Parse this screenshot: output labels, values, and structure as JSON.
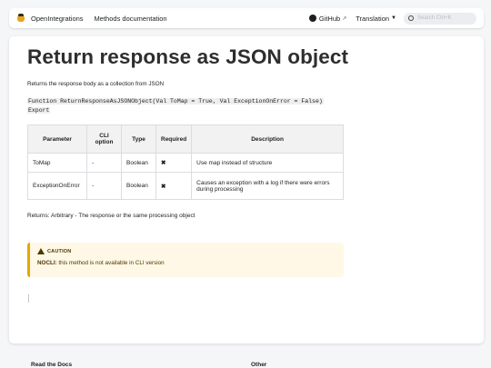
{
  "navbar": {
    "brand": "OpenIntegrations",
    "links": [
      "Methods documentation"
    ],
    "github": "GitHub",
    "translation": "Translation",
    "search_placeholder": "Search Ctrl+K"
  },
  "page": {
    "title": "Return response as JSON object",
    "description": "Returns the response body as a collection from JSON",
    "code_line1": "Function ReturnResponseAsJSONObject(Val ToMap = True, Val ExceptionOnError = False)",
    "code_line2": "Export"
  },
  "table": {
    "headers": [
      "Parameter",
      "CLI option",
      "Type",
      "Required",
      "Description"
    ],
    "rows": [
      [
        "ToMap",
        "-",
        "Boolean",
        "✖",
        "Use map instead of structure"
      ],
      [
        "ExceptionOnError",
        "-",
        "Boolean",
        "✖",
        "Causes an exception with a log if there were errors during processing"
      ]
    ]
  },
  "returns": "Returns: Arbitrary - The response or the same processing object",
  "caution": {
    "title": "CAUTION",
    "label": "NOCLI:",
    "text": " this method is not available in CLI version"
  },
  "footer": {
    "col1": "Read the Docs",
    "col2": "Other"
  },
  "colors": {
    "caution_bg": "#fff8e6",
    "caution_border": "#e6a700",
    "logo": "#e8a41c"
  },
  "icons": [
    "logo-icon",
    "github-icon",
    "external-link-icon",
    "chevron-down-icon",
    "search-icon",
    "warning-icon"
  ]
}
